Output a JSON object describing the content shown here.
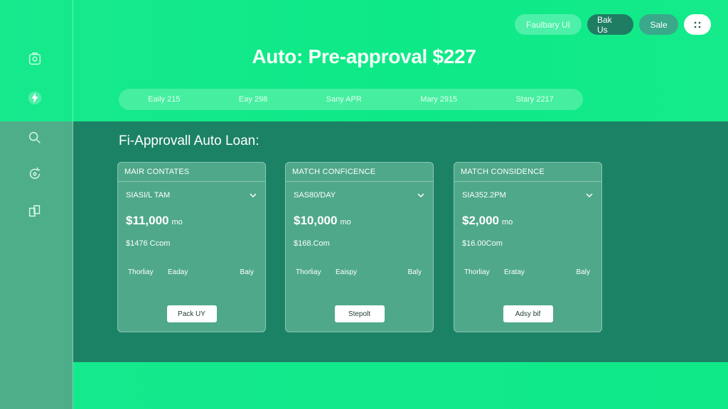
{
  "header": {
    "title": "Auto: Pre-approval $227",
    "pills": [
      {
        "label": "Faulbary UI"
      },
      {
        "label": "Bak Us"
      },
      {
        "label": "Sale"
      },
      {
        "label": "⁜"
      }
    ]
  },
  "sidebar": {
    "items": [
      {
        "icon": "home-icon"
      },
      {
        "icon": "bolt-icon"
      },
      {
        "icon": "search-icon"
      },
      {
        "icon": "refresh-icon"
      },
      {
        "icon": "documents-icon"
      }
    ]
  },
  "tabs": [
    {
      "label": "Eaily 215"
    },
    {
      "label": "Eay 298"
    },
    {
      "label": "Sany APR"
    },
    {
      "label": "Mary 2915"
    },
    {
      "label": "Stary 2217"
    }
  ],
  "section": {
    "title": "Fi-Approvall Auto Loan:"
  },
  "cards": [
    {
      "header": "MAIR CONTATES",
      "subtitle": "SIASI/L TAM",
      "amount": "$11,000",
      "amount_unit": "mo",
      "detail": "$1476 Ccom",
      "row": [
        "Thorliay",
        "Eaday",
        "Baiy"
      ],
      "button": "Pack UY"
    },
    {
      "header": "MATCH CONFICENCE",
      "subtitle": "SAS80/DAY",
      "amount": "$10,000",
      "amount_unit": "mo",
      "detail": "$168.Com",
      "row": [
        "Thorliay",
        "Eaispy",
        "Baly"
      ],
      "button": "Stepolt"
    },
    {
      "header": "MATCH CONSIDENCE",
      "subtitle": "SIA352.2PM",
      "amount": "$2,000",
      "amount_unit": "mo",
      "detail": "$16.00Com",
      "row": [
        "Thorliay",
        "Eratay",
        "Baly"
      ],
      "button": "Adsy bif"
    }
  ],
  "colors": {
    "accent_green": "#0fe88c",
    "panel_dark": "#1c8266",
    "card_bg": "#4fa88a"
  }
}
